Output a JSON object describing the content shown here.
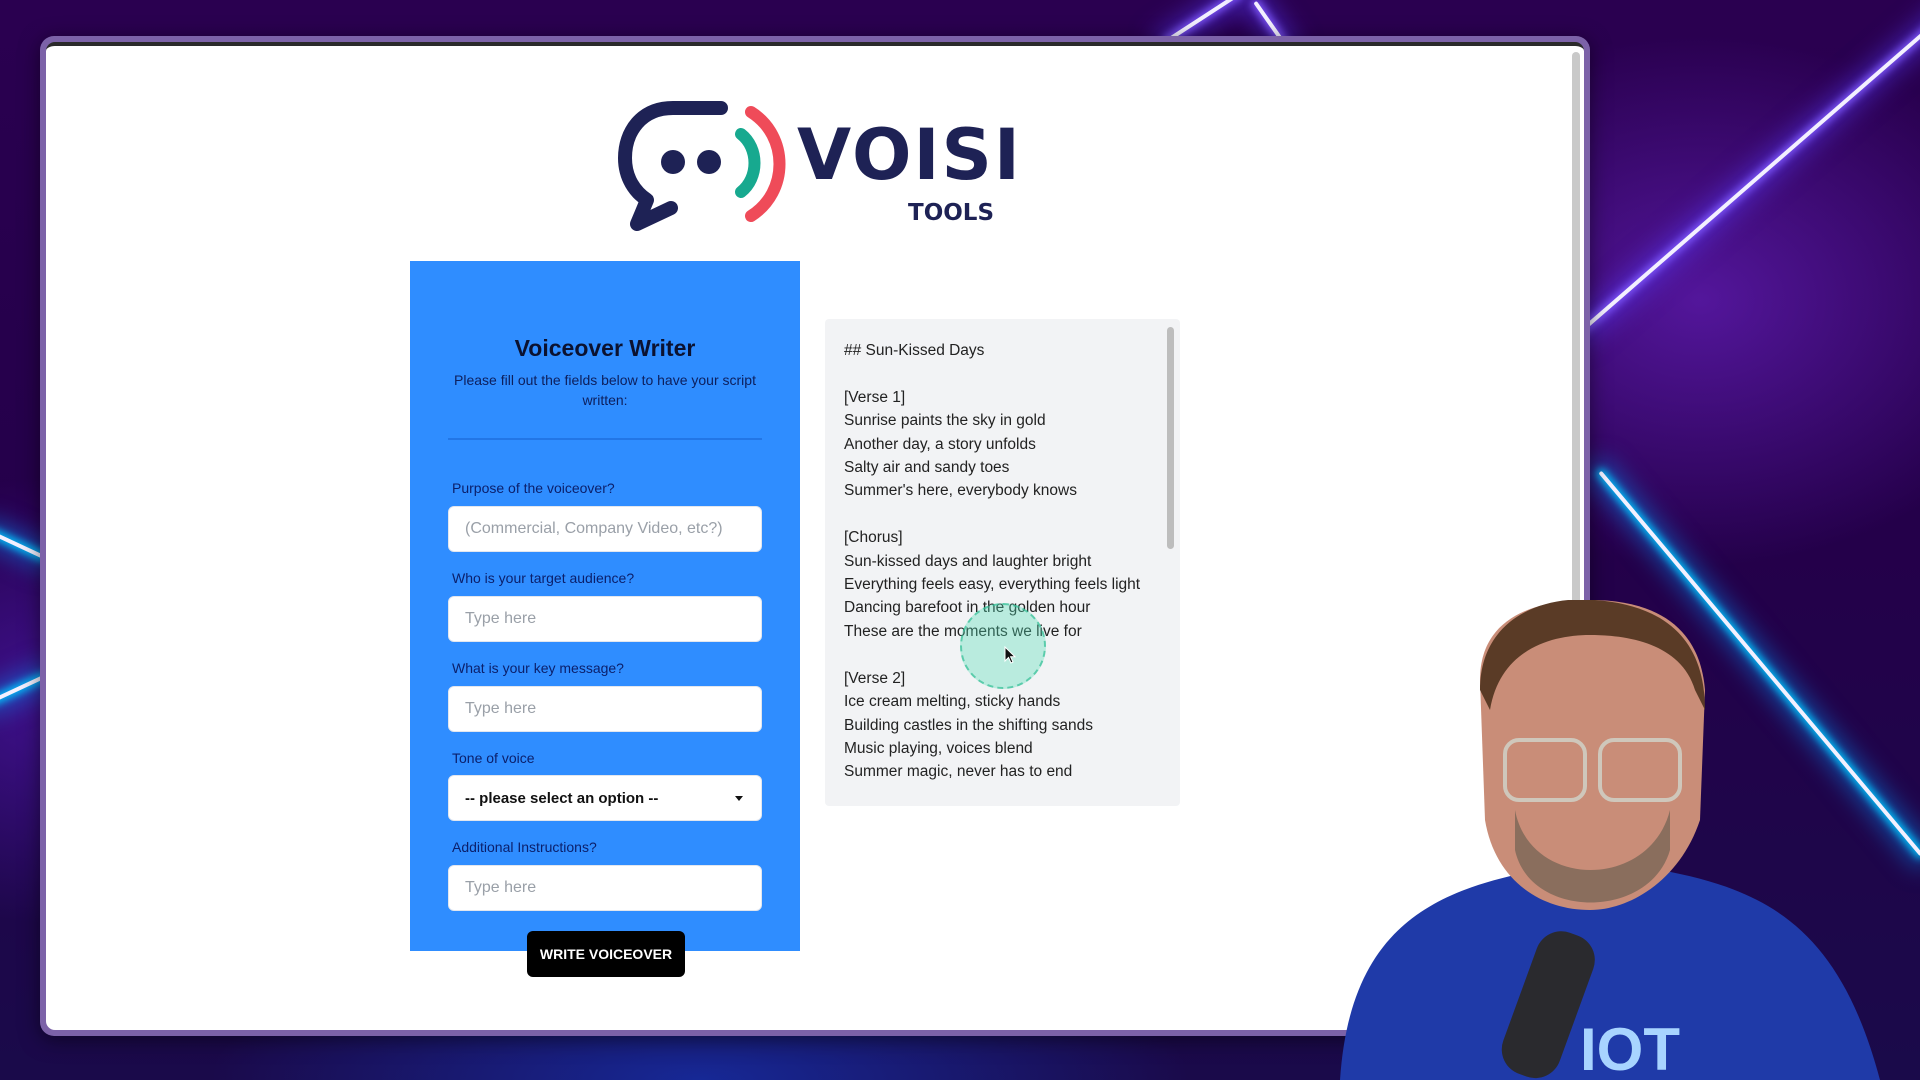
{
  "app": {
    "brand": "VOISI",
    "brand_sub": "TOOLS",
    "colors": {
      "card_blue": "#2f8dff",
      "logo_navy": "#1e2255",
      "logo_teal": "#17a98f",
      "logo_red": "#ef4b59"
    }
  },
  "form": {
    "title": "Voiceover Writer",
    "subtitle": "Please fill out the fields below to have your script written:",
    "fields": [
      {
        "label": "Purpose of the voiceover?",
        "placeholder": "(Commercial, Company Video, etc?)",
        "value": ""
      },
      {
        "label": "Who is your target audience?",
        "placeholder": "Type here",
        "value": ""
      },
      {
        "label": "What is your key message?",
        "placeholder": "Type here",
        "value": ""
      },
      {
        "label": "Tone of voice",
        "selected": "-- please select an option --"
      },
      {
        "label": "Additional Instructions?",
        "placeholder": "Type here",
        "value": ""
      }
    ],
    "submit_label": "WRITE VOICEOVER"
  },
  "output": {
    "icons": [
      "refresh-icon",
      "copy-icon"
    ],
    "lines": [
      "## Sun-Kissed Days",
      "",
      "[Verse 1]",
      "Sunrise paints the sky in gold",
      "Another day, a story unfolds",
      "Salty air and sandy toes",
      "Summer's here, everybody knows",
      "",
      "[Chorus]",
      "Sun-kissed days and laughter bright",
      "Everything feels easy, everything feels light",
      "Dancing barefoot in the golden hour",
      "These are the moments we live for",
      "",
      "[Verse 2]",
      "Ice cream melting, sticky hands",
      "Building castles in the shifting sands",
      "Music playing, voices blend",
      "Summer magic, never has to end"
    ]
  },
  "overlay": {
    "webcam": "presenter-webcam"
  }
}
